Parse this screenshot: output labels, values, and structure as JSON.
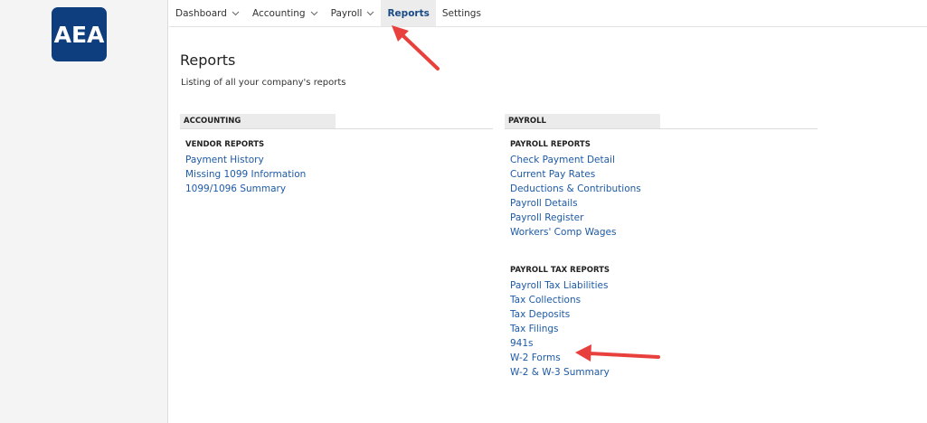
{
  "brand": {
    "logo_text": "AEA",
    "logo_color": "#0f3e7e"
  },
  "nav": {
    "items": [
      {
        "label": "Dashboard",
        "has_dropdown": true,
        "active": false
      },
      {
        "label": "Accounting",
        "has_dropdown": true,
        "active": false
      },
      {
        "label": "Payroll",
        "has_dropdown": true,
        "active": false
      },
      {
        "label": "Reports",
        "has_dropdown": false,
        "active": true
      },
      {
        "label": "Settings",
        "has_dropdown": false,
        "active": false
      }
    ]
  },
  "page": {
    "title": "Reports",
    "subtitle": "Listing of all your company's reports"
  },
  "accounting": {
    "header": "ACCOUNTING",
    "groups": [
      {
        "title": "VENDOR REPORTS",
        "links": [
          "Payment History",
          "Missing 1099 Information",
          "1099/1096 Summary"
        ]
      }
    ]
  },
  "payroll": {
    "header": "PAYROLL",
    "groups": [
      {
        "title": "PAYROLL REPORTS",
        "links": [
          "Check Payment Detail",
          "Current Pay Rates",
          "Deductions & Contributions",
          "Payroll Details",
          "Payroll Register",
          "Workers' Comp Wages"
        ]
      },
      {
        "title": "PAYROLL TAX REPORTS",
        "links": [
          "Payroll Tax Liabilities",
          "Tax Collections",
          "Tax Deposits",
          "Tax Filings",
          "941s",
          "W-2 Forms",
          "W-2 & W-3 Summary"
        ]
      }
    ]
  },
  "colors": {
    "link": "#1d5aa6",
    "annotation_arrow": "#e8413d",
    "active_tab_bg": "#ececec"
  }
}
